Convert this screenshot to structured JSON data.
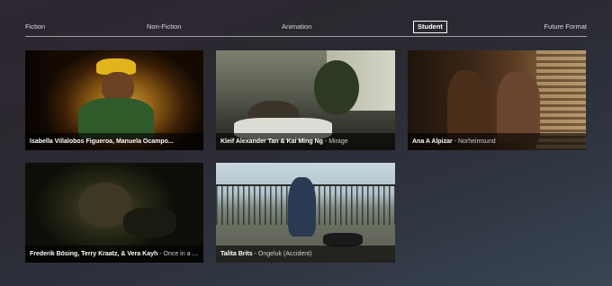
{
  "nav": {
    "items": [
      {
        "label": "Fiction",
        "active": false
      },
      {
        "label": "Non-Fiction",
        "active": false
      },
      {
        "label": "Animation",
        "active": false
      },
      {
        "label": "Student",
        "active": true
      },
      {
        "label": "Future Format",
        "active": false
      }
    ]
  },
  "cards": [
    {
      "names": "Isabella Villalobos Figueroa, Manuela Ocampo...",
      "sep": "",
      "title": ""
    },
    {
      "names": "Kleif Alexander Tan & Kai Ming Ng",
      "sep": " - ",
      "title": "Mirage"
    },
    {
      "names": "Ana A Alpizar",
      "sep": " - ",
      "title": "Norheimsund"
    },
    {
      "names": "Frederik Bösing, Terry Kraatz, & Vera Kayh",
      "sep": " - ",
      "title": "Once in a Bl..."
    },
    {
      "names": "Talita Brits",
      "sep": " - ",
      "title": "Ongeluk (Accident)"
    }
  ]
}
